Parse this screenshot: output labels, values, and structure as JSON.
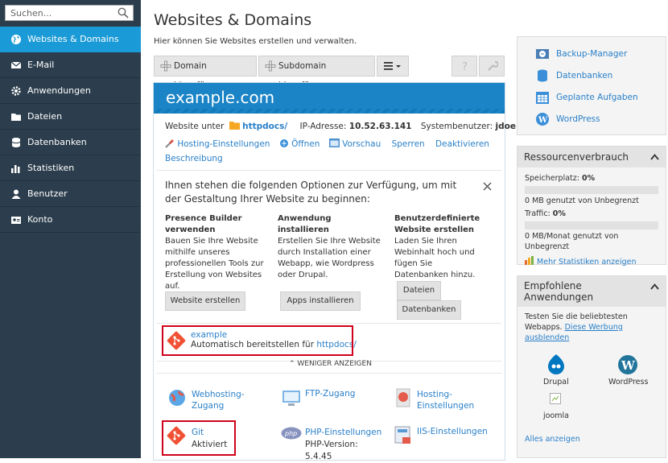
{
  "search": {
    "placeholder": "Suchen..."
  },
  "nav": [
    {
      "label": "Websites & Domains",
      "icon": "globe-icon",
      "active": true
    },
    {
      "label": "E-Mail",
      "icon": "mail-icon"
    },
    {
      "label": "Anwendungen",
      "icon": "gear-icon"
    },
    {
      "label": "Dateien",
      "icon": "folder-icon"
    },
    {
      "label": "Datenbanken",
      "icon": "database-icon"
    },
    {
      "label": "Statistiken",
      "icon": "chart-icon"
    },
    {
      "label": "Benutzer",
      "icon": "user-icon"
    },
    {
      "label": "Konto",
      "icon": "account-icon"
    }
  ],
  "page": {
    "title": "Websites & Domains",
    "subtitle": "Hier können Sie Websites erstellen und verwalten."
  },
  "toolbar": {
    "add_domain": "Domain hinzufügen",
    "add_subdomain": "Subdomain hinzufügen"
  },
  "domain": {
    "name": "example.com",
    "website_under": "Website unter",
    "docroot": "httpdocs/",
    "ip_label": "IP-Adresse:",
    "ip": "10.52.63.141",
    "sysuser_label": "Systembenutzer:",
    "sysuser": "jdoe",
    "actions": [
      "Hosting-Einstellungen",
      "Öffnen",
      "Vorschau",
      "Sperren",
      "Deaktivieren"
    ],
    "description": "Beschreibung"
  },
  "options": {
    "intro": "Ihnen stehen die folgenden Optionen zur Verfügung, um mit der Gestaltung Ihrer Website zu beginnen:",
    "cols": [
      {
        "head": "Presence Builder verwenden",
        "text": "Bauen Sie Ihre Website mithilfe unseres professionellen Tools zur Erstellung von Websites auf.",
        "buttons": [
          "Website erstellen"
        ]
      },
      {
        "head": "Anwendung installieren",
        "text": "Erstellen Sie Ihre Website durch Installation einer Webapp, wie Wordpress oder Drupal.",
        "buttons": [
          "Apps installieren"
        ]
      },
      {
        "head": "Benutzerdefinierte Website erstellen",
        "text": "Laden Sie Ihren Webinhalt hoch und fügen Sie Datenbanken hinzu.",
        "buttons": [
          "Dateien",
          "Datenbanken"
        ]
      }
    ]
  },
  "git_repo": {
    "name": "example",
    "deploy": "Automatisch bereitstellen für",
    "path": "httpdocs/"
  },
  "less": "WENIGER ANZEIGEN",
  "tools": [
    {
      "label": "Webhosting-Zugang",
      "icon": "webhosting-icon"
    },
    {
      "label": "FTP-Zugang",
      "icon": "ftp-icon"
    },
    {
      "label": "Hosting-Einstellungen",
      "icon": "hosting-settings-icon"
    },
    {
      "label": "Git",
      "status": "Aktiviert",
      "icon": "git-icon"
    },
    {
      "label": "PHP-Einstellungen",
      "status": "PHP-Version: 5.4.45",
      "icon": "php-icon"
    },
    {
      "label": "IIS-Einstellungen",
      "icon": "iis-icon"
    }
  ],
  "rightlinks": [
    "Backup-Manager",
    "Datenbanken",
    "Geplante Aufgaben",
    "WordPress"
  ],
  "resources": {
    "title": "Ressourcenverbrauch",
    "disk_label": "Speicherplatz:",
    "disk_pct": "0%",
    "disk_text": "0 MB genutzt von Unbegrenzt",
    "traffic_label": "Traffic:",
    "traffic_pct": "0%",
    "traffic_text": "0 MB/Monat genutzt von Unbegrenzt",
    "more": "Mehr Statistiken anzeigen"
  },
  "apps": {
    "title": "Empfohlene Anwendungen",
    "text": "Testen Sie die beliebtesten Webapps.",
    "hide_link": "Diese Werbung ausblenden",
    "items": [
      "Drupal",
      "WordPress",
      "joomla"
    ],
    "all": "Alles anzeigen"
  }
}
